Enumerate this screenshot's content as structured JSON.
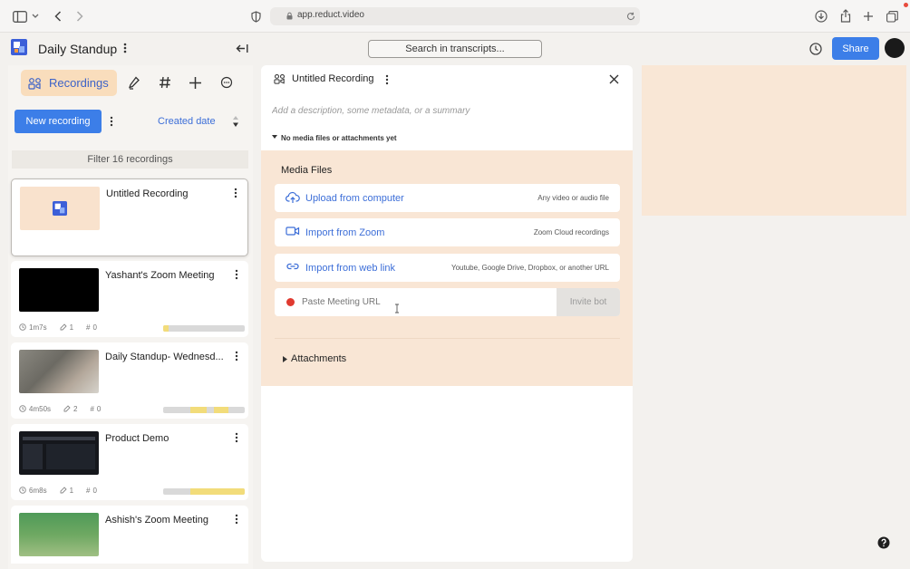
{
  "browser": {
    "url": "app.reduct.video"
  },
  "header": {
    "project_title": "Daily Standup",
    "search_label": "Search in transcripts...",
    "share_label": "Share"
  },
  "sidebar": {
    "tab_label": "Recordings",
    "new_recording_label": "New recording",
    "sort_label": "Created date",
    "filter_label": "Filter 16 recordings",
    "recordings": [
      {
        "title": "Untitled Recording",
        "duration": "",
        "speakers": "",
        "tags": ""
      },
      {
        "title": "Yashant's Zoom Meeting",
        "duration": "1m7s",
        "speakers": "1",
        "tags": "0"
      },
      {
        "title": "Daily Standup- Wednesd...",
        "duration": "4m50s",
        "speakers": "2",
        "tags": "0"
      },
      {
        "title": "Product Demo",
        "duration": "6m8s",
        "speakers": "1",
        "tags": "0"
      },
      {
        "title": "Ashish's Zoom Meeting",
        "duration": "",
        "speakers": "",
        "tags": ""
      }
    ]
  },
  "recording_panel": {
    "title": "Untitled Recording",
    "description_placeholder": "Add a description, some metadata, or a summary",
    "no_media_text": "No media files or attachments yet",
    "media_files_label": "Media Files",
    "options": [
      {
        "label": "Upload from computer",
        "sub": "Any video or audio file",
        "icon": "cloud-upload-icon"
      },
      {
        "label": "Import from Zoom",
        "sub": "Zoom Cloud recordings",
        "icon": "video-camera-icon"
      },
      {
        "label": "Import from web link",
        "sub": "Youtube, Google Drive, Dropbox, or another URL",
        "icon": "link-icon"
      }
    ],
    "meeting_url_placeholder": "Paste Meeting URL",
    "invite_bot_label": "Invite bot",
    "attachments_label": "Attachments"
  },
  "colors": {
    "accent": "#3c7ee8",
    "tab_highlight": "#f9ddbc",
    "panel_peach": "#f9e6d5",
    "record_dot": "#e03a30"
  }
}
